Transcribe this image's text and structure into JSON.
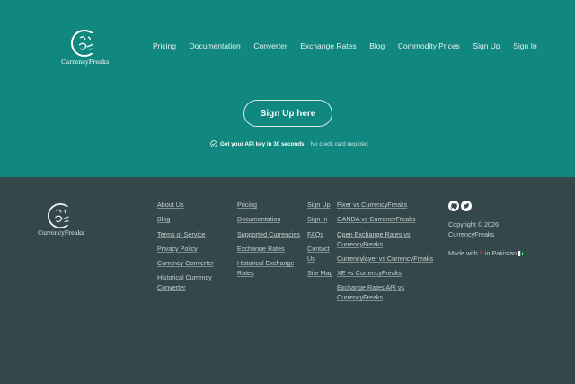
{
  "brand": {
    "name": "CurrencyFreaks"
  },
  "nav": {
    "items": [
      "Pricing",
      "Documentation",
      "Converter",
      "Exchange Rates",
      "Blog",
      "Commodity Prices",
      "Sign Up",
      "Sign In"
    ]
  },
  "hero": {
    "cta_label": "Sign Up here",
    "api_text": "Get your API key in 30 seconds",
    "no_card_text": "No credit card required"
  },
  "footer": {
    "col1": [
      "About Us",
      "Blog",
      "Terms of Service",
      "Privacy Policy",
      "Currency Converter",
      "Historical Currency Converter"
    ],
    "col2": [
      "Pricing",
      "Documentation",
      "Supported Currencies",
      "Exchange Rates",
      "Historical Exchange Rates"
    ],
    "col3": [
      "Sign Up",
      "Sign In",
      "FAQs",
      "Contact Us",
      "Site Map"
    ],
    "col4": [
      "Fixer vs CurrencyFreaks",
      "OANDA vs CurrencyFreaks",
      "Open Exchange Rates vs CurrencyFreaks",
      "Currencylayer vs CurrencyFreaks",
      "XE vs CurrencyFreaks",
      "Exchange Rates API vs CurrencyFreaks"
    ],
    "copyright_line1": "Copyright © 2026",
    "copyright_line2": "CurrencyFreaks",
    "made_prefix": "Made with",
    "made_suffix": "in Pakistan",
    "icons": [
      "github-icon",
      "twitter-icon",
      "heart-icon",
      "pakistan-flag-icon"
    ]
  },
  "colors": {
    "header_bg": "#10877f",
    "footer_bg": "#34474a",
    "accent_white": "#ffffff"
  }
}
